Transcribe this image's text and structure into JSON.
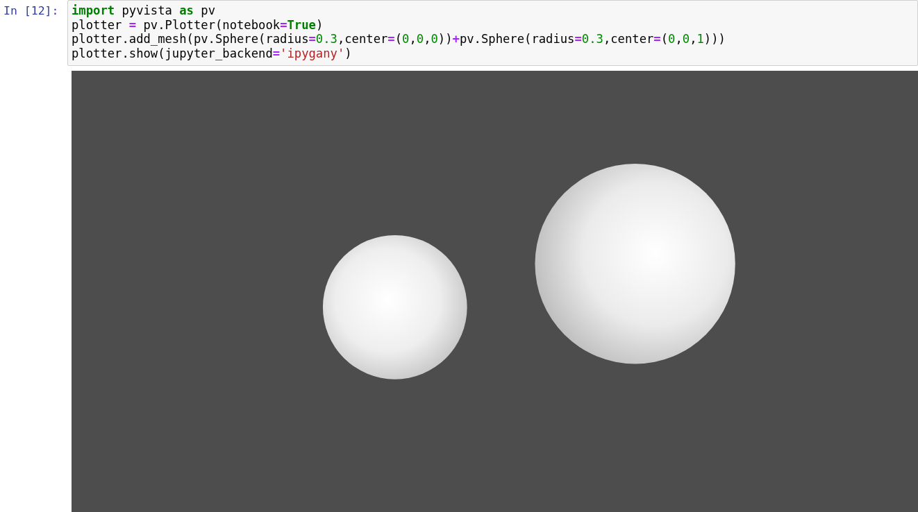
{
  "cell": {
    "prompt": "In [12]:",
    "code_lines": [
      [
        {
          "kind": "keyword",
          "text": "import"
        },
        {
          "kind": "plain",
          "text": " pyvista "
        },
        {
          "kind": "keyword",
          "text": "as"
        },
        {
          "kind": "plain",
          "text": " pv"
        }
      ],
      [
        {
          "kind": "plain",
          "text": "plotter "
        },
        {
          "kind": "operator",
          "text": "="
        },
        {
          "kind": "plain",
          "text": " pv.Plotter(notebook"
        },
        {
          "kind": "operator",
          "text": "="
        },
        {
          "kind": "keyword",
          "text": "True"
        },
        {
          "kind": "plain",
          "text": ")"
        }
      ],
      [
        {
          "kind": "plain",
          "text": "plotter.add_mesh(pv.Sphere(radius"
        },
        {
          "kind": "operator",
          "text": "="
        },
        {
          "kind": "number",
          "text": "0.3"
        },
        {
          "kind": "plain",
          "text": ",center"
        },
        {
          "kind": "operator",
          "text": "="
        },
        {
          "kind": "plain",
          "text": "("
        },
        {
          "kind": "number",
          "text": "0"
        },
        {
          "kind": "plain",
          "text": ","
        },
        {
          "kind": "number",
          "text": "0"
        },
        {
          "kind": "plain",
          "text": ","
        },
        {
          "kind": "number",
          "text": "0"
        },
        {
          "kind": "plain",
          "text": "))"
        },
        {
          "kind": "operator",
          "text": "+"
        },
        {
          "kind": "plain",
          "text": "pv.Sphere(radius"
        },
        {
          "kind": "operator",
          "text": "="
        },
        {
          "kind": "number",
          "text": "0.3"
        },
        {
          "kind": "plain",
          "text": ",center"
        },
        {
          "kind": "operator",
          "text": "="
        },
        {
          "kind": "plain",
          "text": "("
        },
        {
          "kind": "number",
          "text": "0"
        },
        {
          "kind": "plain",
          "text": ","
        },
        {
          "kind": "number",
          "text": "0"
        },
        {
          "kind": "plain",
          "text": ","
        },
        {
          "kind": "number",
          "text": "1"
        },
        {
          "kind": "plain",
          "text": ")))"
        }
      ],
      [
        {
          "kind": "plain",
          "text": "plotter.show(jupyter_backend"
        },
        {
          "kind": "operator",
          "text": "="
        },
        {
          "kind": "string",
          "text": "'ipygany'"
        },
        {
          "kind": "plain",
          "text": ")"
        }
      ]
    ]
  }
}
